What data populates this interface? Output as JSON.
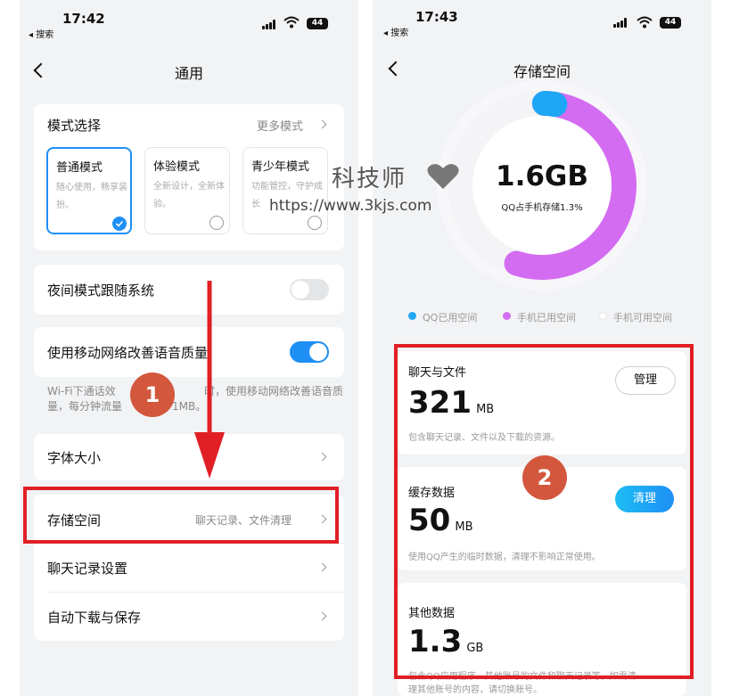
{
  "left": {
    "status": {
      "time": "17:42",
      "back_app": "◂ 搜索",
      "battery": "44"
    },
    "title": "通用",
    "mode_section": {
      "title": "模式选择",
      "more_label": "更多模式",
      "modes": [
        {
          "title": "普通模式",
          "desc": "随心使用，畅享装扮。",
          "selected": true
        },
        {
          "title": "体验模式",
          "desc": "全新设计，全新体验。",
          "selected": false
        },
        {
          "title": "青少年模式",
          "desc": "功能管控，守护成长",
          "selected": false
        }
      ]
    },
    "night_mode": {
      "label": "夜间模式跟随系统",
      "on": false
    },
    "mobile_voice": {
      "label": "使用移动网络改善语音质量",
      "on": true,
      "desc_line1": "Wi-Fi下通话效",
      "desc_line1b": "时，使用移动网络改善语音质",
      "desc_line1c": "量，每分钟流量",
      "desc_line1d": "1MB。"
    },
    "font_size": {
      "label": "字体大小"
    },
    "storage": {
      "label": "存储空间",
      "hint": "聊天记录、文件清理"
    },
    "chat_settings": {
      "label": "聊天记录设置"
    },
    "auto_download": {
      "label": "自动下载与保存"
    },
    "step_badge": "1"
  },
  "right": {
    "status": {
      "time": "17:43",
      "back_app": "◂ 搜索",
      "battery": "44"
    },
    "title": "存储空间",
    "ring": {
      "value": "1.6GB",
      "subtitle": "QQ占手机存储1.3%",
      "qq_fraction": 0.013,
      "phone_used_fraction": 0.55
    },
    "legend": [
      {
        "label": "QQ已用空间",
        "color": "#1ea7f5"
      },
      {
        "label": "手机已用空间",
        "color": "#d46cf2"
      },
      {
        "label": "手机可用空间",
        "color": "#f4f4f6"
      }
    ],
    "sections": [
      {
        "title": "聊天与文件",
        "amount": "321",
        "unit": "MB",
        "desc": "包含聊天记录、文件以及下载的资源。",
        "button": "管理"
      },
      {
        "title": "缓存数据",
        "amount": "50",
        "unit": "MB",
        "desc": "使用QQ产生的临时数据，清理不影响正常使用。",
        "button": "清理"
      },
      {
        "title": "其他数据",
        "amount": "1.3",
        "unit": "GB",
        "desc": "包含QQ应用程序、其他账号的文件和聊天记录等，如需清",
        "desc2": "理其他账号的内容，请切换账号。"
      }
    ],
    "step_badge": "2"
  },
  "watermark": {
    "text": "科技师",
    "url": "https://www.3kjs.com"
  }
}
